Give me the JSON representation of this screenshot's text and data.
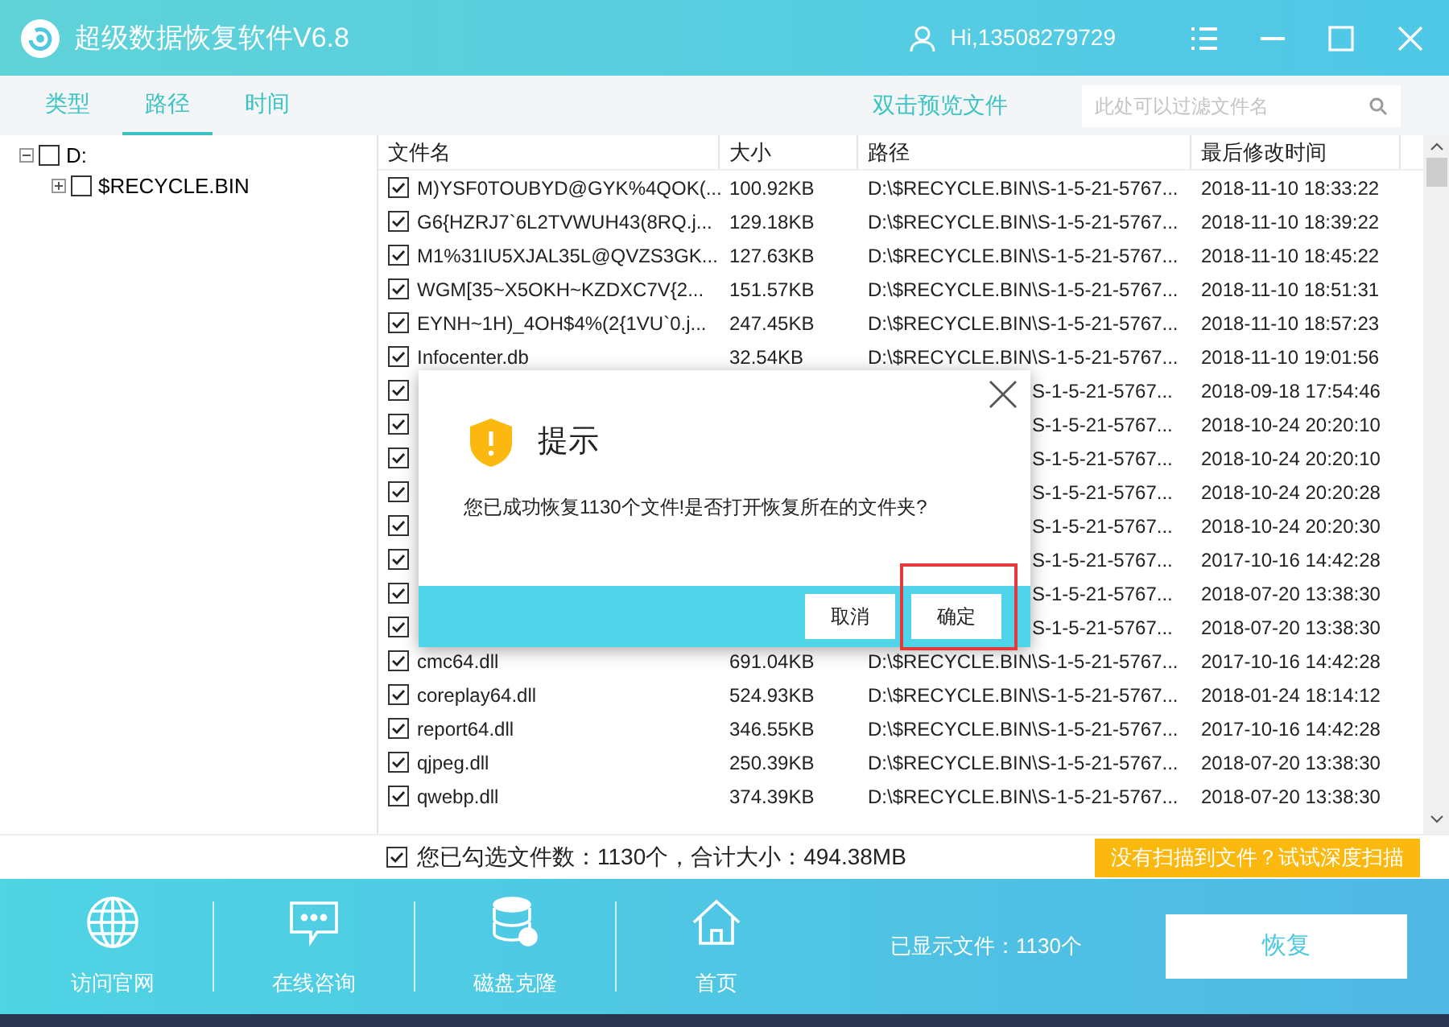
{
  "window": {
    "title": "超级数据恢复软件V6.8",
    "user": "Hi,13508279729"
  },
  "tabs": [
    {
      "label": "类型",
      "selected": false
    },
    {
      "label": "路径",
      "selected": true
    },
    {
      "label": "时间",
      "selected": false
    }
  ],
  "preview_hint": "双击预览文件",
  "search": {
    "placeholder": "此处可以过滤文件名"
  },
  "tree": [
    {
      "label": "D:",
      "checked": false,
      "expanded": true,
      "children": [
        {
          "label": "$RECYCLE.BIN",
          "checked": false,
          "expanded": false
        }
      ]
    }
  ],
  "table": {
    "columns": [
      "文件名",
      "大小",
      "路径",
      "最后修改时间"
    ],
    "rows": [
      {
        "kind": "full",
        "checked": true,
        "name": "M)YSF0TOUBYD@GYK%4QOK(...",
        "size": "100.92KB",
        "path": "D:\\$RECYCLE.BIN\\S-1-5-21-5767...",
        "modified": "2018-11-10 18:33:22"
      },
      {
        "kind": "full",
        "checked": true,
        "name": "G6{HZRJ7`6L2TVWUH43(8RQ.j...",
        "size": "129.18KB",
        "path": "D:\\$RECYCLE.BIN\\S-1-5-21-5767...",
        "modified": "2018-11-10 18:39:22"
      },
      {
        "kind": "full",
        "checked": true,
        "name": "M1%31IU5XJAL35L@QVZS3GK...",
        "size": "127.63KB",
        "path": "D:\\$RECYCLE.BIN\\S-1-5-21-5767...",
        "modified": "2018-11-10 18:45:22"
      },
      {
        "kind": "full",
        "checked": true,
        "name": "WGM[35~X5OKH~KZDXC7V{2...",
        "size": "151.57KB",
        "path": "D:\\$RECYCLE.BIN\\S-1-5-21-5767...",
        "modified": "2018-11-10 18:51:31"
      },
      {
        "kind": "full",
        "checked": true,
        "name": "EYNH~1H)_4OH$4%(2{1VU`0.j...",
        "size": "247.45KB",
        "path": "D:\\$RECYCLE.BIN\\S-1-5-21-5767...",
        "modified": "2018-11-10 18:57:23"
      },
      {
        "kind": "full",
        "checked": true,
        "name": "Infocenter.db",
        "size": "32.54KB",
        "path": "D:\\$RECYCLE.BIN\\S-1-5-21-5767...",
        "modified": "2018-11-10 19:01:56"
      },
      {
        "kind": "covered",
        "checked": true,
        "path": "S-1-5-21-5767...",
        "modified": "2018-09-18 17:54:46"
      },
      {
        "kind": "covered",
        "checked": true,
        "path": "S-1-5-21-5767...",
        "modified": "2018-10-24 20:20:10"
      },
      {
        "kind": "covered",
        "checked": true,
        "path": "S-1-5-21-5767...",
        "modified": "2018-10-24 20:20:10"
      },
      {
        "kind": "covered",
        "checked": true,
        "path": "S-1-5-21-5767...",
        "modified": "2018-10-24 20:20:28"
      },
      {
        "kind": "covered",
        "checked": true,
        "path": "S-1-5-21-5767...",
        "modified": "2018-10-24 20:20:30"
      },
      {
        "kind": "covered",
        "checked": true,
        "path": "S-1-5-21-5767...",
        "modified": "2017-10-16 14:42:28"
      },
      {
        "kind": "covered",
        "checked": true,
        "path": "S-1-5-21-5767...",
        "modified": "2018-07-20 13:38:30"
      },
      {
        "kind": "covered",
        "checked": true,
        "path": "S-1-5-21-5767...",
        "modified": "2018-07-20 13:38:30"
      },
      {
        "kind": "full",
        "checked": true,
        "name": "cmc64.dll",
        "size": "691.04KB",
        "path": "D:\\$RECYCLE.BIN\\S-1-5-21-5767...",
        "modified": "2017-10-16 14:42:28"
      },
      {
        "kind": "full",
        "checked": true,
        "name": "coreplay64.dll",
        "size": "524.93KB",
        "path": "D:\\$RECYCLE.BIN\\S-1-5-21-5767...",
        "modified": "2018-01-24 18:14:12"
      },
      {
        "kind": "full",
        "checked": true,
        "name": "report64.dll",
        "size": "346.55KB",
        "path": "D:\\$RECYCLE.BIN\\S-1-5-21-5767...",
        "modified": "2017-10-16 14:42:28"
      },
      {
        "kind": "full",
        "checked": true,
        "name": "qjpeg.dll",
        "size": "250.39KB",
        "path": "D:\\$RECYCLE.BIN\\S-1-5-21-5767...",
        "modified": "2018-07-20 13:38:30"
      },
      {
        "kind": "full",
        "checked": true,
        "name": "qwebp.dll",
        "size": "374.39KB",
        "path": "D:\\$RECYCLE.BIN\\S-1-5-21-5767...",
        "modified": "2018-07-20 13:38:30"
      }
    ]
  },
  "summary": {
    "checked": true,
    "text": "您已勾选文件数：1130个，合计大小：494.38MB"
  },
  "deep_scan_button": "没有扫描到文件？试试深度扫描",
  "bottom_nav": [
    {
      "kind": "globe",
      "label": "访问官网"
    },
    {
      "kind": "chat",
      "label": "在线咨询"
    },
    {
      "kind": "disk",
      "label": "磁盘克隆"
    },
    {
      "kind": "home",
      "label": "首页"
    }
  ],
  "shown_count": "已显示文件：1130个",
  "recover_button": "恢复",
  "dialog": {
    "title": "提示",
    "message": "您已成功恢复1130个文件!是否打开恢复所在的文件夹?",
    "buttons": [
      {
        "label": "取消",
        "highlighted": false
      },
      {
        "label": "确定",
        "highlighted": true
      }
    ]
  }
}
